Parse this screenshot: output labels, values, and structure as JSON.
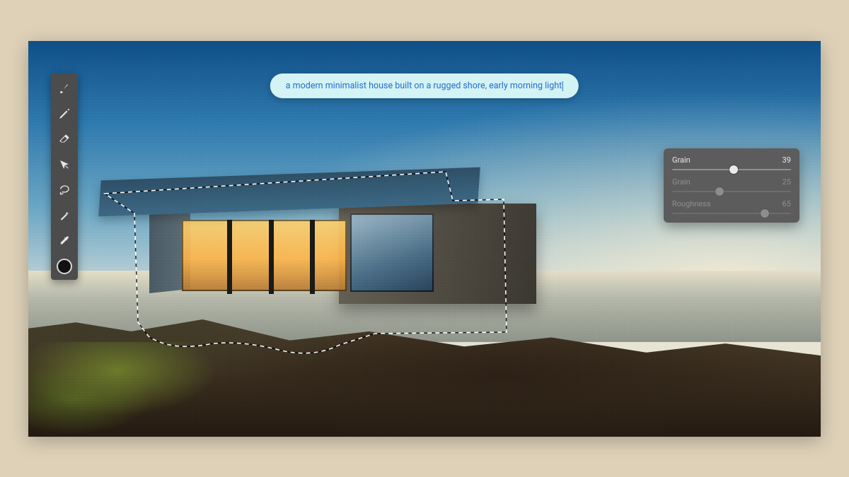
{
  "prompt": {
    "text": "a modern minimalist house built on a rugged shore, early morning light"
  },
  "toolbar": {
    "tools": [
      "brush",
      "pencil",
      "eraser",
      "move",
      "lasso",
      "wand",
      "eyedropper"
    ]
  },
  "panel": {
    "sliders": [
      {
        "label": "Grain",
        "value": 39,
        "percent": 52,
        "active": true
      },
      {
        "label": "Grain",
        "value": 25,
        "percent": 40,
        "active": false
      },
      {
        "label": "Roughness",
        "value": 65,
        "percent": 78,
        "active": false
      }
    ]
  },
  "colors": {
    "panel_bg": "#5c5c5c",
    "toolbar_bg": "#4c4c4c",
    "prompt_bg": "#d4f3f5",
    "prompt_text": "#256ecf",
    "page_bg": "#ded1b8"
  }
}
